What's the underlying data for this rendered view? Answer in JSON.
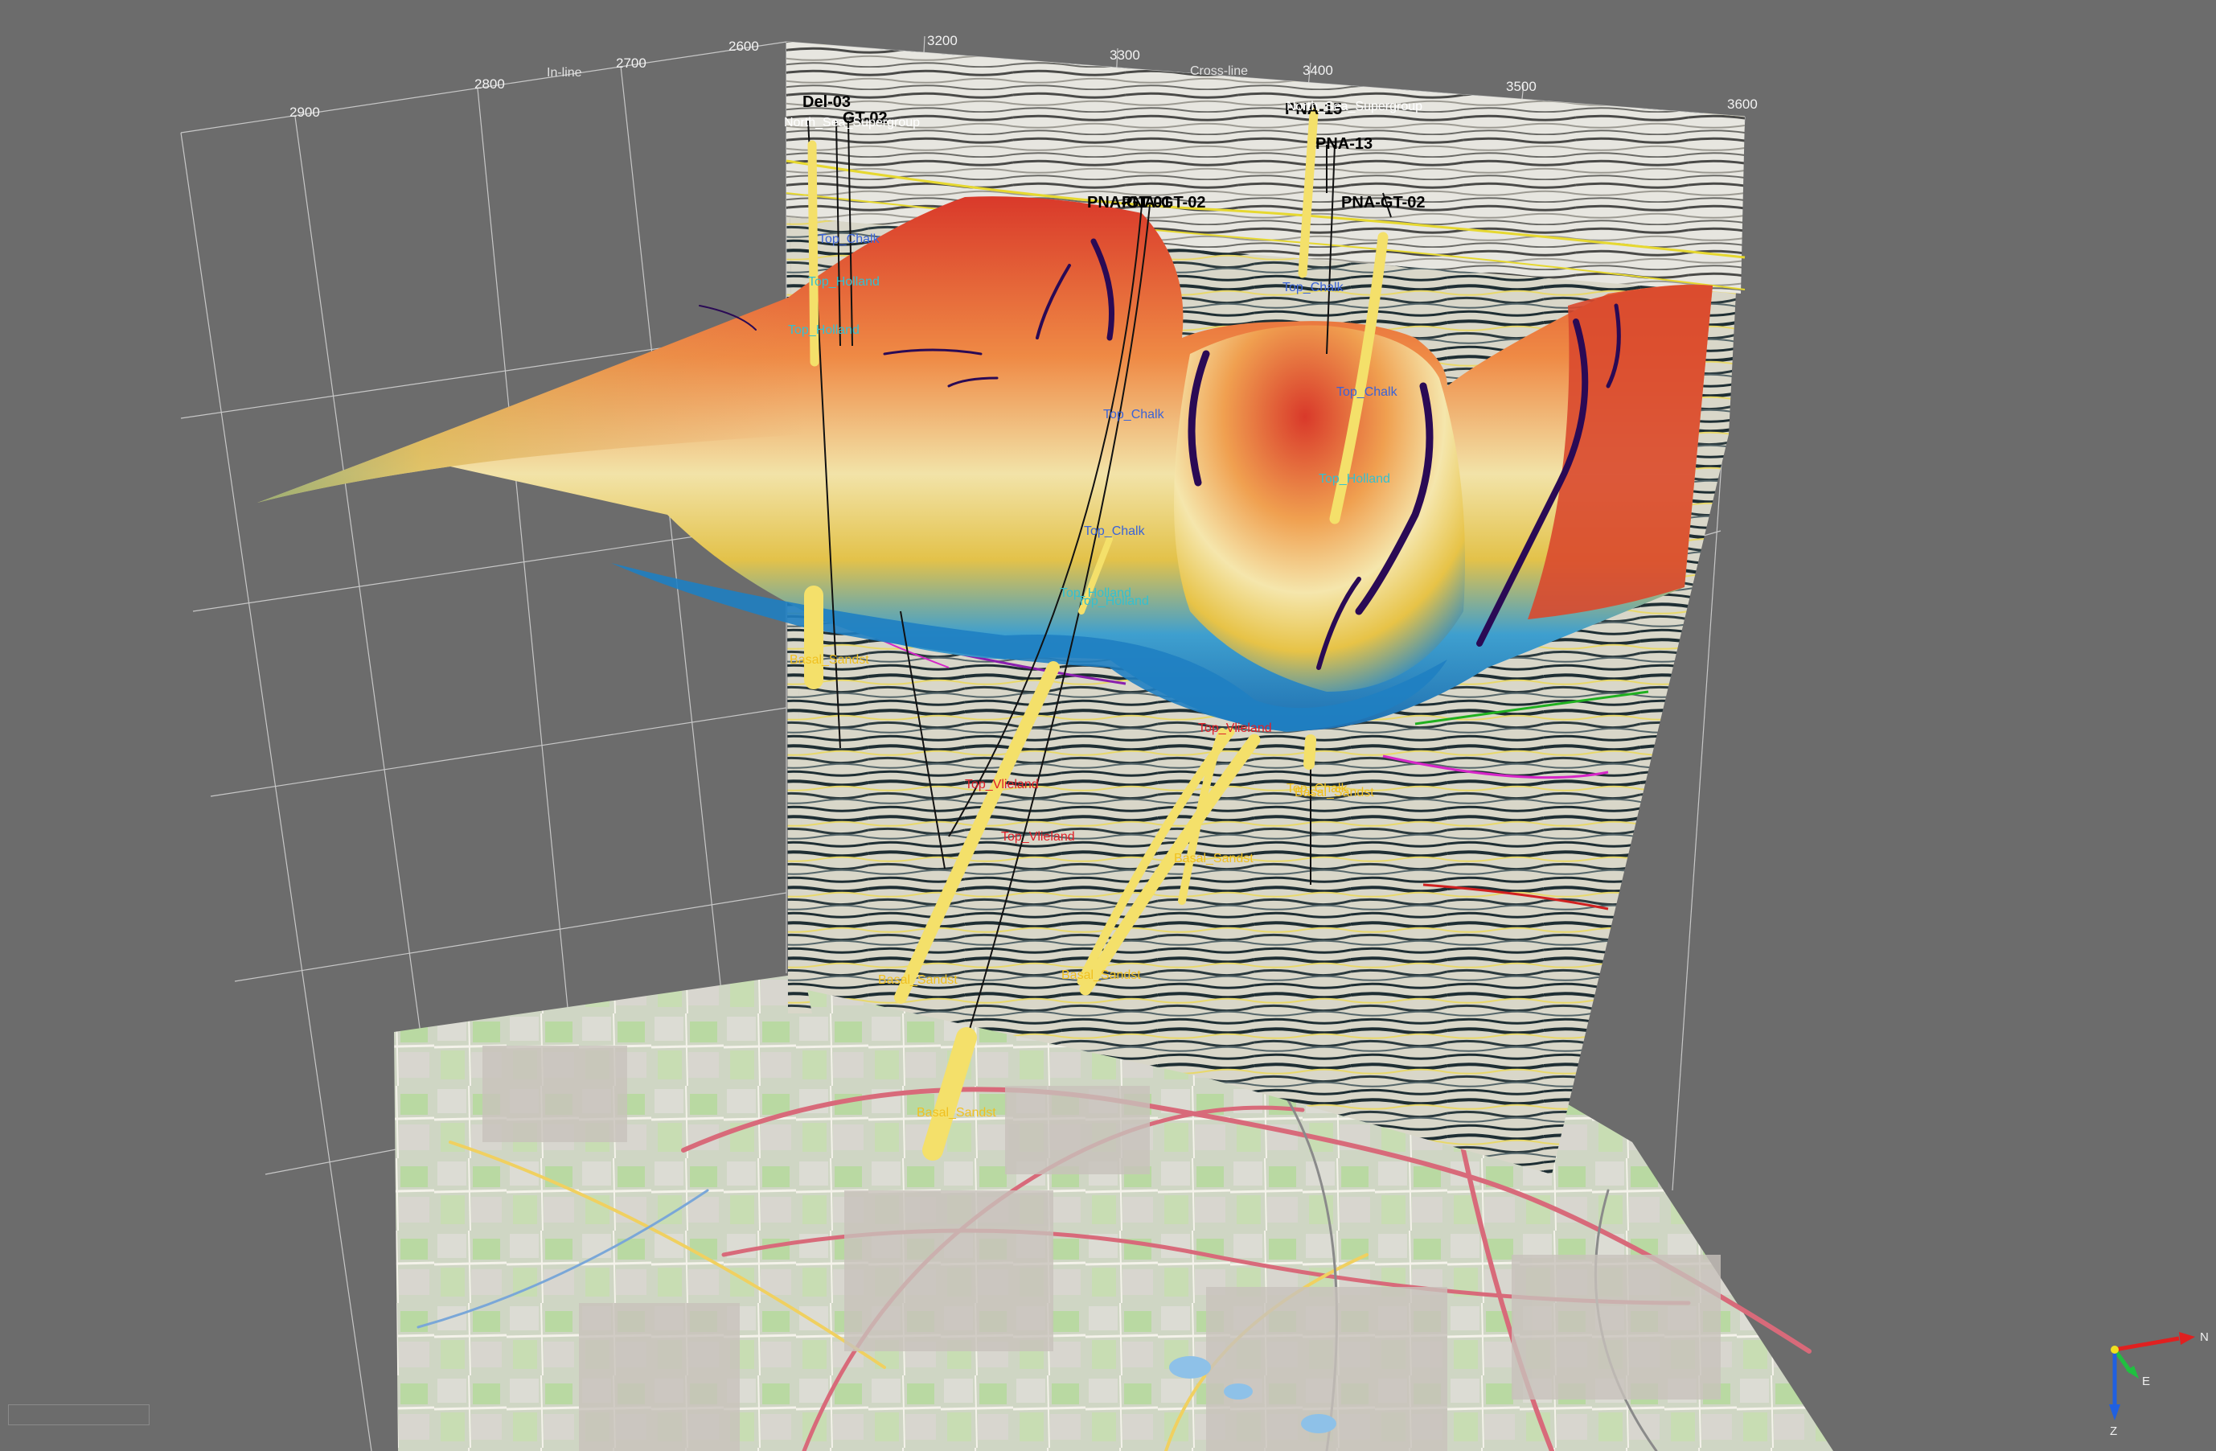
{
  "axes": {
    "inline_title": "In-line",
    "crossline_title": "Cross-line",
    "inline_ticks": [
      "2900",
      "2800",
      "2700",
      "2600"
    ],
    "crossline_ticks": [
      "3200",
      "3300",
      "3400",
      "3500",
      "3600"
    ]
  },
  "wells": {
    "del03": "Del-03",
    "gt02_left": "GT-02",
    "pna15": "PNA-15",
    "pna13": "PNA-13",
    "pnagt02": "PNA-GT-02",
    "pnagt01": "PNA-GT-01",
    "pnagt02b": "PNA-GT-02"
  },
  "horizons": {
    "north_sea_left": "North_Sea_Supergroup",
    "north_sea_right": "North_Sea_Supergroup",
    "top_chalk_1": "Top_Chalk",
    "top_chalk_2": "Top_Chalk",
    "top_chalk_3": "Top_Chalk",
    "top_chalk_4": "Top_Chalk",
    "top_chalk_5": "Top_Chalk",
    "top_chalk_6": "Top_Chalk",
    "top_holland_1": "Top_Holland",
    "top_holland_2": "Top_Holland",
    "top_holland_3": "Top_Holland",
    "top_holland_4": "Top_Holland",
    "top_holland_5": "Top_Holland",
    "top_vlieland_1": "Top_Vlieland",
    "top_vlieland_2": "Top_Vlieland",
    "top_vlieland_3": "Top_Vlieland",
    "basal_1": "Basal_Sandst",
    "basal_2": "Basal_Sandst",
    "basal_3": "Basal_Sandst",
    "basal_4": "Basal_Sandst",
    "basal_5": "Basal_Sandst",
    "basal_6": "Basal_Sandst"
  },
  "orientation": {
    "north": "N",
    "east": "E",
    "down": "Z"
  },
  "colors": {
    "background": "#6c6c6c",
    "surface_high": "#d9392a",
    "surface_mid": "#f2e3a8",
    "surface_low": "#1f87c9",
    "well_tube": "#f4e06a",
    "top_chalk": "#3a63d8",
    "top_holland": "#34c0d0",
    "top_vlieland": "#e0202a",
    "basal": "#f0c020"
  }
}
